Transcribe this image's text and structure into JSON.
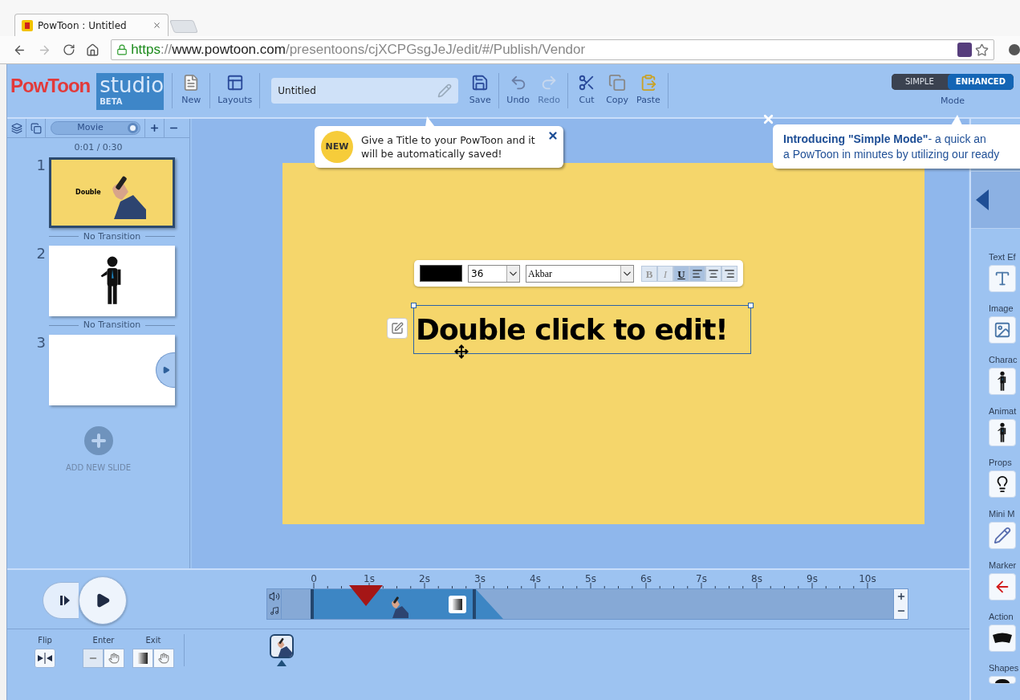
{
  "browser": {
    "tab_title": "PowToon : Untitled",
    "url": {
      "scheme": "https",
      "separator": "://",
      "host": "www.powtoon.com",
      "path": "/presentoons/cjXCPGsgJeJ/edit/#/Publish/Vendor"
    }
  },
  "toolbar": {
    "logo": "PowToon",
    "product": "studio",
    "badge": "BETA",
    "groups": [
      {
        "items": [
          {
            "kind": "new",
            "label": "New",
            "disabled": false
          }
        ]
      },
      {
        "items": [
          {
            "kind": "layouts",
            "label": "Layouts",
            "disabled": false
          }
        ]
      },
      {
        "items": [
          {
            "kind": "title_field",
            "value": "Untitled"
          },
          {
            "kind": "save",
            "label": "Save",
            "disabled": false
          }
        ]
      },
      {
        "items": [
          {
            "kind": "undo",
            "label": "Undo",
            "disabled": false
          },
          {
            "kind": "redo",
            "label": "Redo",
            "disabled": true
          }
        ]
      },
      {
        "items": [
          {
            "kind": "cut",
            "label": "Cut",
            "disabled": false
          },
          {
            "kind": "copy",
            "label": "Copy",
            "disabled": false
          },
          {
            "kind": "paste",
            "label": "Paste",
            "disabled": false
          }
        ]
      }
    ],
    "mode": {
      "label": "Mode",
      "options": [
        {
          "label": "SIMPLE",
          "selected": false
        },
        {
          "label": "ENHANCED",
          "selected": true
        }
      ]
    }
  },
  "title_tip": {
    "badge": "NEW",
    "text": "Give a Title to your PowToon and it will be automatically saved!"
  },
  "mode_tip": {
    "lines": [
      "**Introducing \"Simple Mode\"**- a quick an",
      "a PowToon in minutes by utilizing our ready"
    ]
  },
  "slides_panel": {
    "movie_toggle": {
      "label": "Movie",
      "on": true
    },
    "time": "0:01 / 0:30",
    "slides": [
      {
        "number": "1",
        "selected": true,
        "kind": "hand",
        "text": "Double",
        "transition": "No Transition"
      },
      {
        "number": "2",
        "selected": false,
        "kind": "character",
        "transition": "No Transition"
      },
      {
        "number": "3",
        "selected": false,
        "kind": "blank"
      }
    ],
    "add_slide": "ADD NEW SLIDE"
  },
  "text_toolbar": {
    "size": "36",
    "font": "Akbar",
    "styles": [
      {
        "label": "B",
        "on": false
      },
      {
        "label": "I",
        "on": false
      },
      {
        "label": "U",
        "on": true
      }
    ],
    "align": [
      {
        "kind": "left",
        "selected": true
      },
      {
        "kind": "center",
        "selected": false
      },
      {
        "kind": "right",
        "selected": false
      }
    ]
  },
  "text_box": "Double click to edit!",
  "library": {
    "categories": [
      {
        "label": "Text Ef",
        "kind": "text"
      },
      {
        "label": "Image",
        "kind": "image"
      },
      {
        "label": "Charac",
        "kind": "character"
      },
      {
        "label": "Animat",
        "kind": "animated"
      },
      {
        "label": "Props",
        "kind": "props"
      },
      {
        "label": "Mini M",
        "kind": "mini"
      },
      {
        "label": "Marker",
        "kind": "marker"
      },
      {
        "label": "Action",
        "kind": "action"
      },
      {
        "label": "Shapes",
        "kind": "shapes"
      }
    ]
  },
  "timeline": {
    "ruler": [
      "0",
      "1s",
      "2s",
      "3s",
      "4s",
      "5s",
      "6s",
      "7s",
      "8s",
      "9s",
      "10s"
    ],
    "flip": "Flip",
    "enter": "Enter",
    "exit": "Exit"
  }
}
